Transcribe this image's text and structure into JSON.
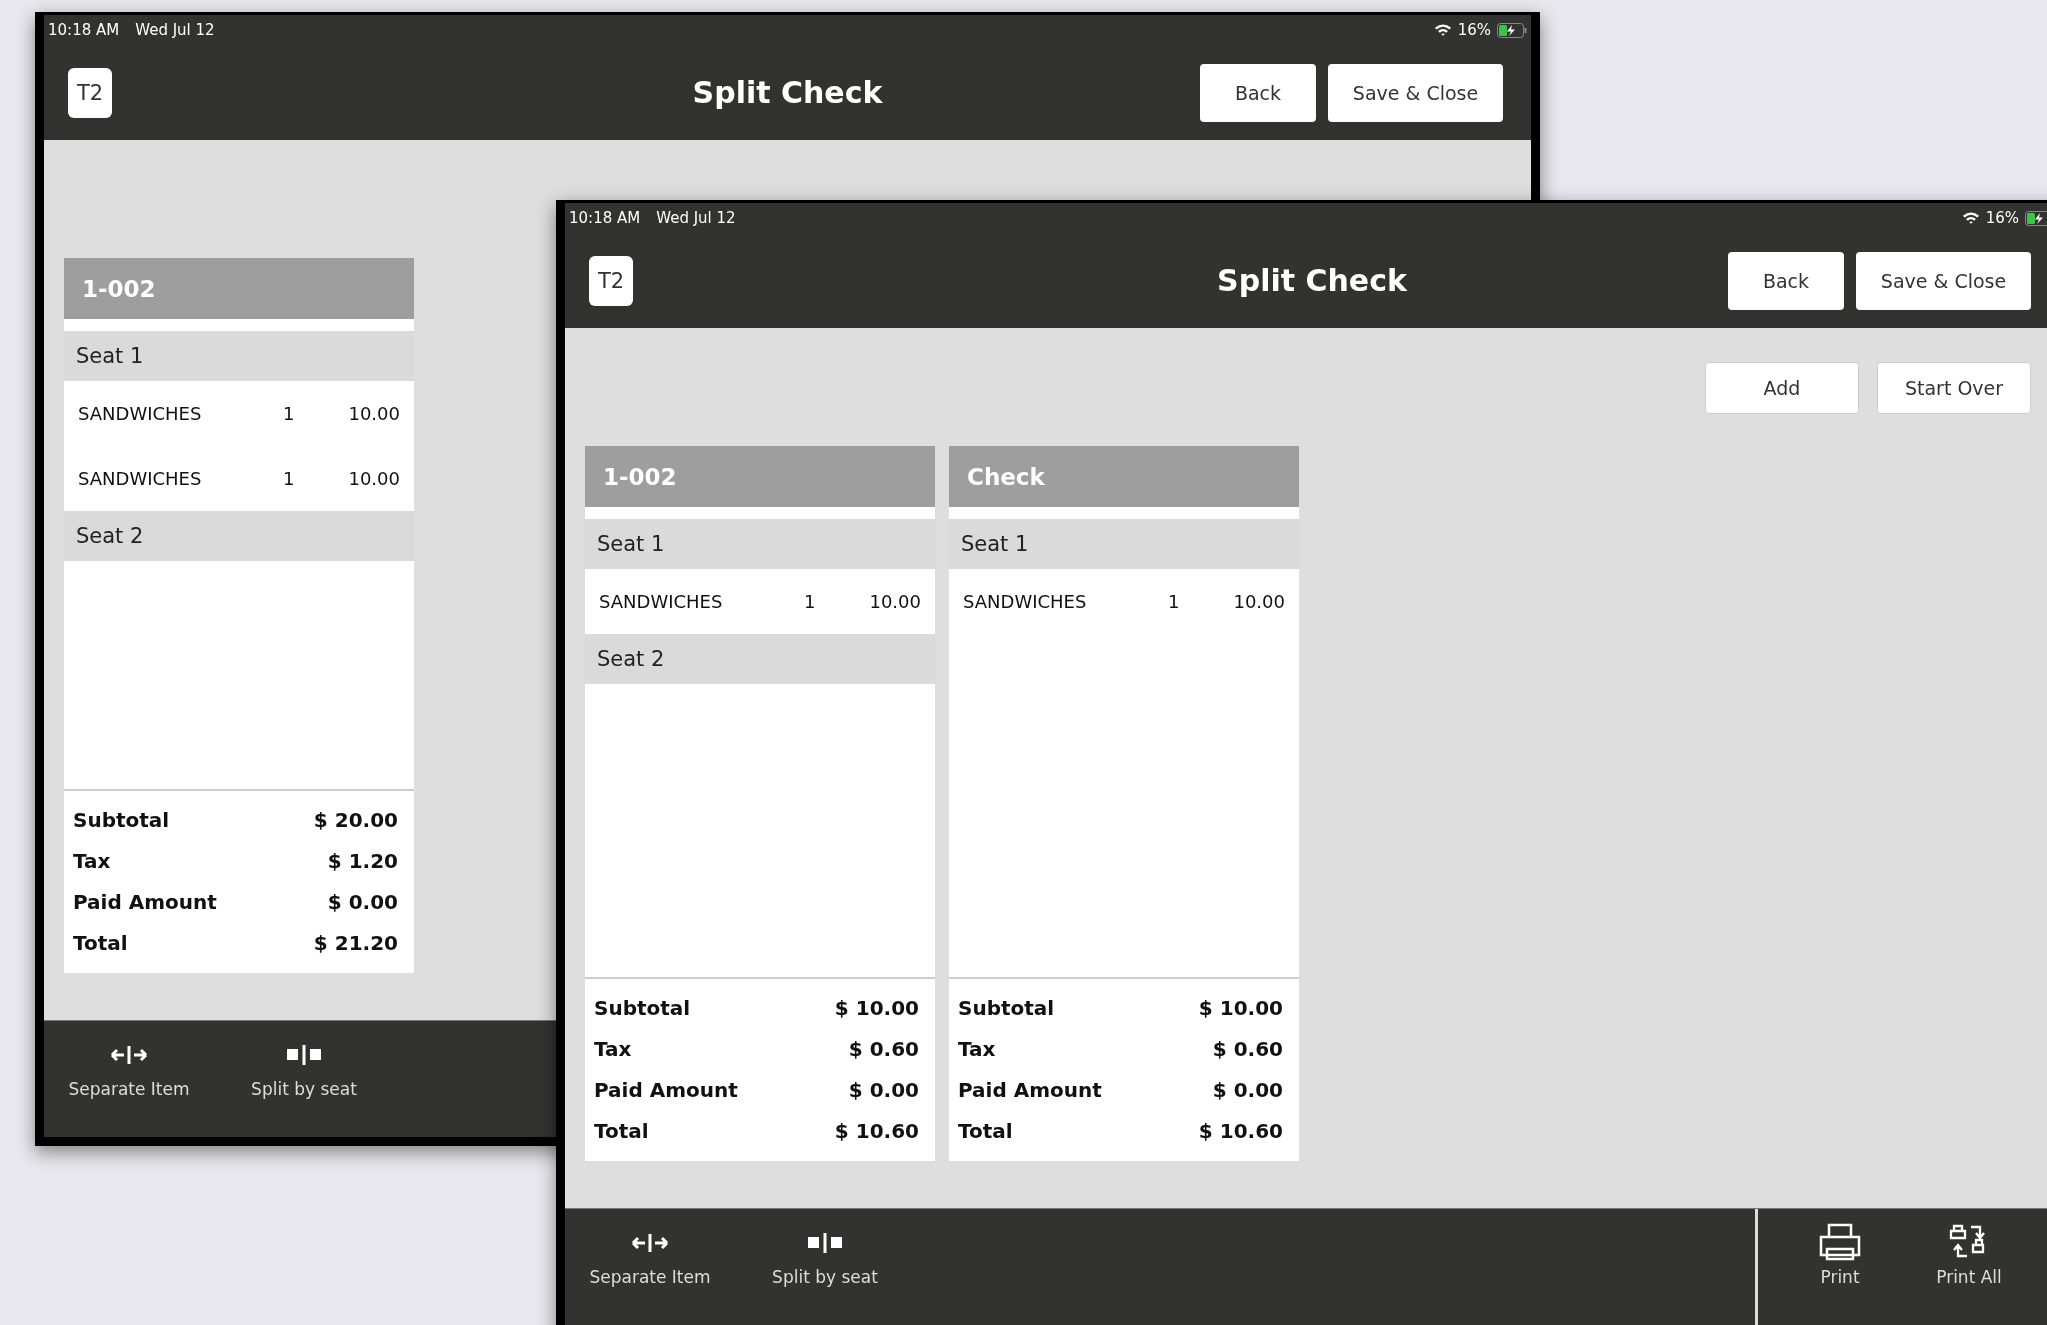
{
  "windows": [
    {
      "status_bar": {
        "time": "10:18 AM",
        "date": "Wed Jul 12",
        "battery": "16%"
      },
      "header": {
        "badge": "T2",
        "title": "Split Check",
        "buttons": [
          "Back",
          "Save & Close"
        ]
      },
      "checks": [
        {
          "title": "1-002",
          "seats": [
            {
              "label": "Seat 1",
              "items": [
                {
                  "name": "SANDWICHES",
                  "qty": "1",
                  "price": "10.00"
                },
                {
                  "name": "SANDWICHES",
                  "qty": "1",
                  "price": "10.00"
                }
              ]
            },
            {
              "label": "Seat 2"
            }
          ],
          "summary": [
            {
              "label": "Subtotal",
              "value": "$ 20.00"
            },
            {
              "label": "Tax",
              "value": "$ 1.20"
            },
            {
              "label": "Paid Amount",
              "value": "$ 0.00"
            },
            {
              "label": "Total",
              "value": "$ 21.20"
            }
          ]
        }
      ],
      "toolbar": [
        {
          "kind": "separate",
          "label": "Separate Item"
        },
        {
          "kind": "split",
          "label": "Split by seat"
        }
      ]
    },
    {
      "status_bar": {
        "time": "10:18 AM",
        "date": "Wed Jul 12",
        "battery": "16%"
      },
      "header": {
        "badge": "T2",
        "title": "Split Check",
        "buttons": [
          "Back",
          "Save & Close"
        ]
      },
      "actions": [
        "Add",
        "Start Over"
      ],
      "checks": [
        {
          "title": "1-002",
          "seats": [
            {
              "label": "Seat 1",
              "items": [
                {
                  "name": "SANDWICHES",
                  "qty": "1",
                  "price": "10.00"
                }
              ]
            },
            {
              "label": "Seat 2"
            }
          ],
          "summary": [
            {
              "label": "Subtotal",
              "value": "$ 10.00"
            },
            {
              "label": "Tax",
              "value": "$ 0.60"
            },
            {
              "label": "Paid Amount",
              "value": "$ 0.00"
            },
            {
              "label": "Total",
              "value": "$ 10.60"
            }
          ]
        },
        {
          "title": "Check",
          "seats": [
            {
              "label": "Seat 1",
              "items": [
                {
                  "name": "SANDWICHES",
                  "qty": "1",
                  "price": "10.00"
                }
              ]
            }
          ],
          "summary": [
            {
              "label": "Subtotal",
              "value": "$ 10.00"
            },
            {
              "label": "Tax",
              "value": "$ 0.60"
            },
            {
              "label": "Paid Amount",
              "value": "$ 0.00"
            },
            {
              "label": "Total",
              "value": "$ 10.60"
            }
          ]
        }
      ],
      "toolbar": [
        {
          "kind": "separate",
          "label": "Separate Item"
        },
        {
          "kind": "split",
          "label": "Split by seat"
        }
      ],
      "print_tools": [
        {
          "kind": "print",
          "label": "Print"
        },
        {
          "kind": "print_all",
          "label": "Print All"
        }
      ]
    }
  ]
}
